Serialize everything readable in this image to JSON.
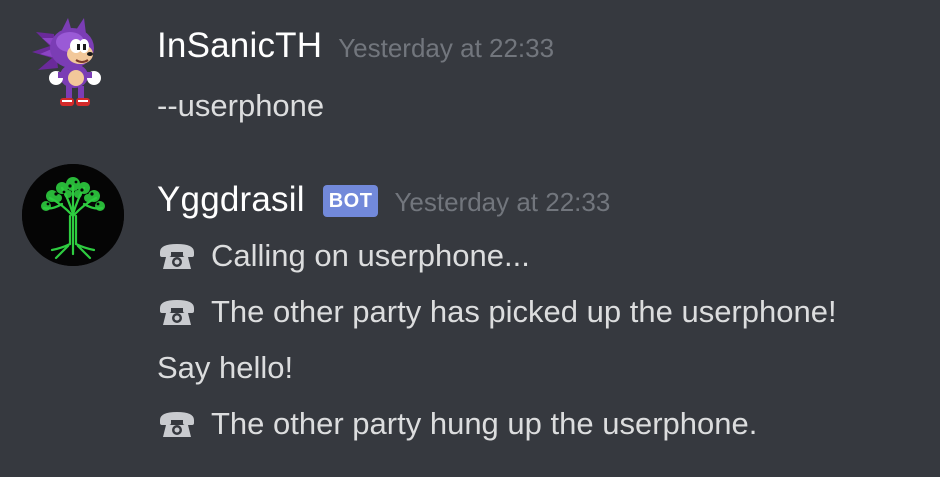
{
  "messages": [
    {
      "author": "InSanicTH",
      "timestamp": "Yesterday at 22:33",
      "is_bot": false,
      "avatar_icon": "sonic-sprite-icon",
      "lines": [
        {
          "icon": null,
          "text": "--userphone"
        }
      ]
    },
    {
      "author": "Yggdrasil",
      "bot_tag": "BOT",
      "timestamp": "Yesterday at 22:33",
      "is_bot": true,
      "avatar_icon": "tree-icon",
      "lines": [
        {
          "icon": "telephone-icon",
          "text": "Calling on userphone..."
        },
        {
          "icon": "telephone-icon",
          "text": "The other party has picked up the userphone!"
        },
        {
          "icon": null,
          "text": "Say hello!"
        },
        {
          "icon": "telephone-icon",
          "text": "The other party hung up the userphone."
        }
      ]
    }
  ],
  "colors": {
    "background": "#36393f",
    "username": "#ffffff",
    "timestamp": "#72767d",
    "message_text": "#dcddde",
    "bot_tag": "#7289da",
    "tree_green": "#2ecc40"
  }
}
